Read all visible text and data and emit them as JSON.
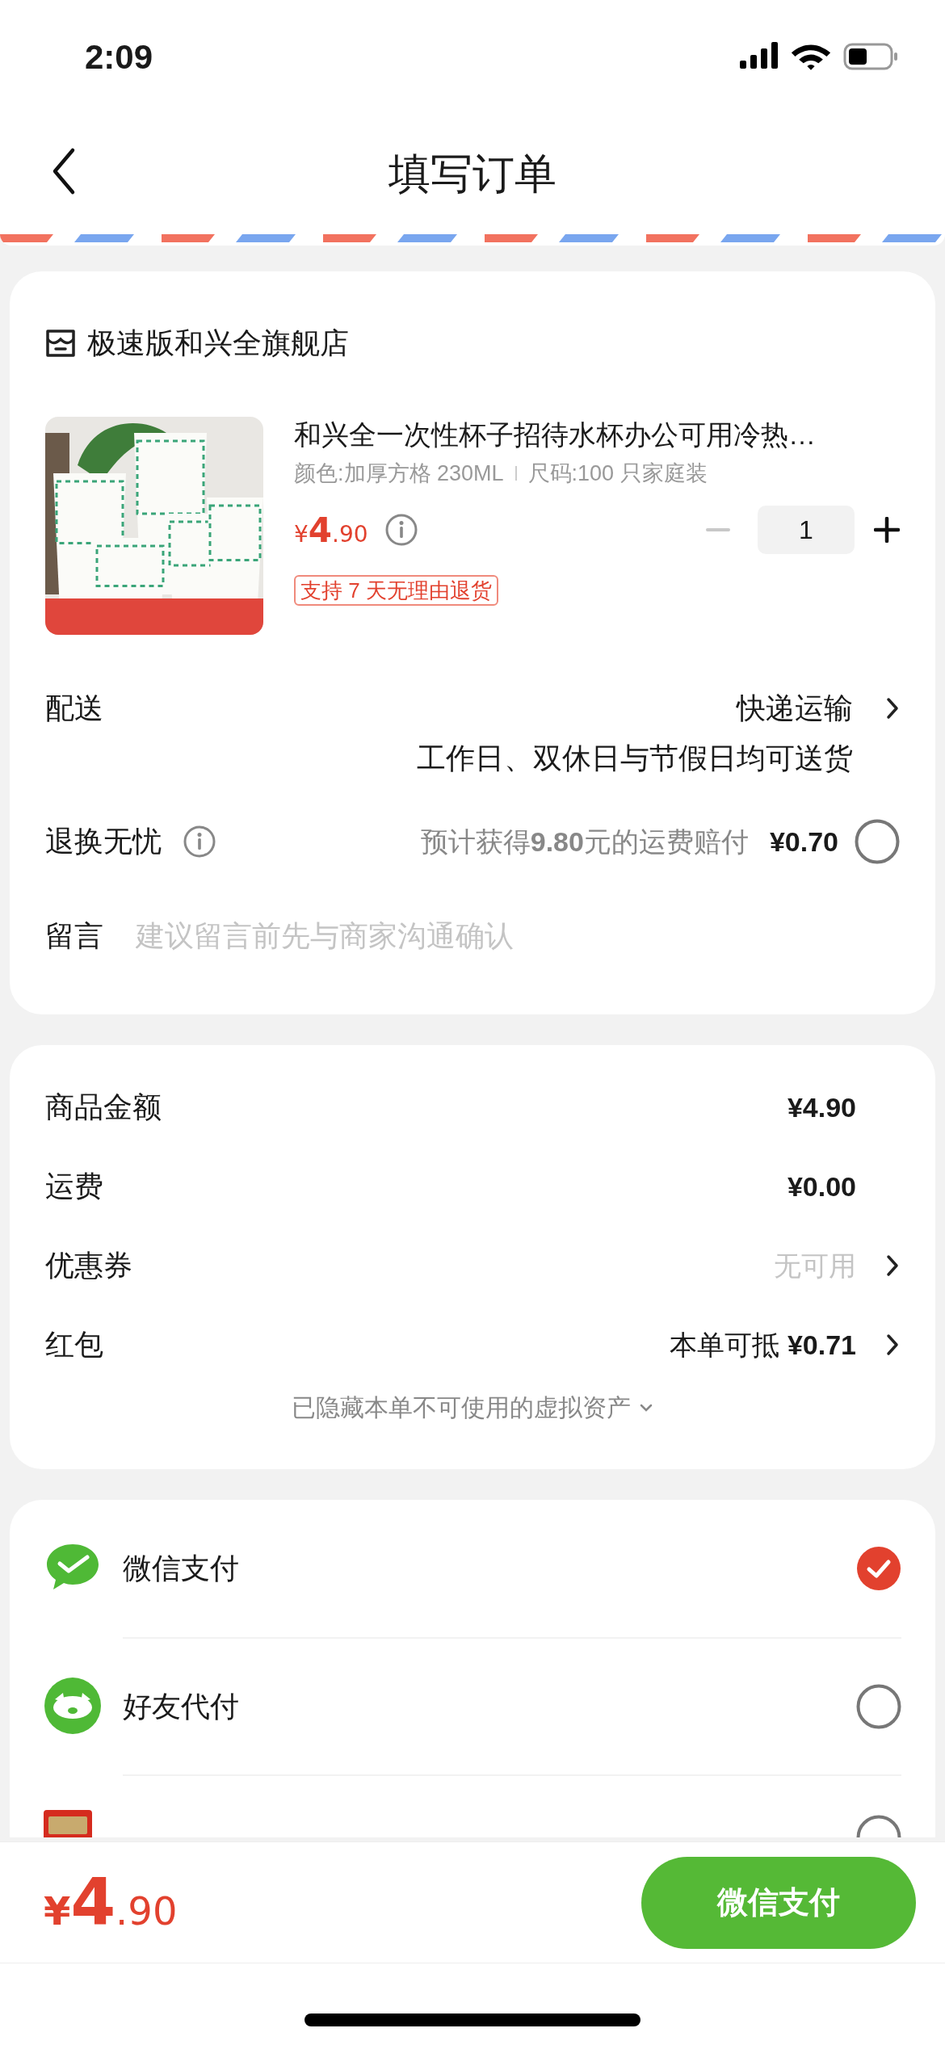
{
  "status_bar": {
    "time": "2:09"
  },
  "nav": {
    "title": "填写订单"
  },
  "store": {
    "name": "极速版和兴全旗舰店"
  },
  "product": {
    "title": "和兴全一次性杯子招待水杯办公可用冷热…",
    "specs": [
      "颜色:加厚方格 230ML",
      "尺码:100 只家庭装"
    ],
    "price": {
      "symbol": "¥",
      "integer": "4",
      "decimal": ".90"
    },
    "quantity": "1",
    "minus_disabled": true,
    "tag": "支持 7 天无理由退货"
  },
  "delivery": {
    "label": "配送",
    "method": "快递运输",
    "note": "工作日、双休日与节假日均可送货"
  },
  "insurance": {
    "label": "退换无忧",
    "description": "预计获得**9.80**元的运费赔付",
    "price": "¥0.70",
    "selected": false
  },
  "message": {
    "label": "留言",
    "placeholder": "建议留言前先与商家沟通确认"
  },
  "summary": {
    "rows": [
      {
        "label": "商品金额",
        "value": "¥4.90",
        "kind": "amount"
      },
      {
        "label": "运费",
        "value": "¥0.00",
        "kind": "amount"
      },
      {
        "label": "优惠券",
        "value": "无可用",
        "kind": "muted-link"
      },
      {
        "label": "红包",
        "value": "本单可抵 **¥0.71**",
        "kind": "link"
      }
    ],
    "hidden_note": "已隐藏本单不可使用的虚拟资产"
  },
  "payments": [
    {
      "name": "微信支付",
      "kind": "wechat",
      "selected": true
    },
    {
      "name": "好友代付",
      "kind": "friend",
      "selected": false
    },
    {
      "kind": "card",
      "selected": false,
      "cropped": true
    }
  ],
  "footer": {
    "total": {
      "symbol": "¥",
      "integer": "4",
      "decimal": ".90"
    },
    "pay_button": "微信支付"
  }
}
